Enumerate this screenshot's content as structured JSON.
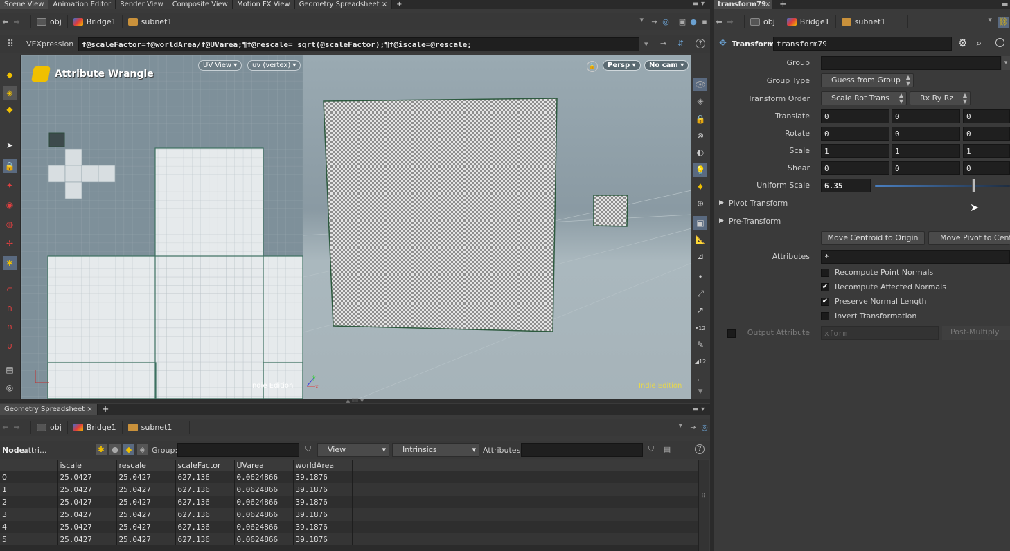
{
  "top_tabs": [
    "Scene View",
    "Animation Editor",
    "Render View",
    "Composite View",
    "Motion FX View",
    "Geometry Spreadsheet"
  ],
  "right_tab": "transform79",
  "path": {
    "obj": "obj",
    "bridge": "Bridge1",
    "subnet": "subnet1"
  },
  "vex": {
    "label": "VEXpression",
    "code": "f@scaleFactor=f@worldArea/f@UVarea;¶f@rescale= sqrt(@scaleFactor);¶f@iscale=@rescale;"
  },
  "uvview": {
    "title": "Attribute Wrangle",
    "uv_view_btn": "UV View ▾",
    "uv_vertex_btn": "uv (vertex) ▾",
    "edition": "Indie Edition"
  },
  "viewport": {
    "persp_btn": "Persp ▾",
    "cam_btn": "No cam ▾",
    "edition": "Indie Edition"
  },
  "params": {
    "node_type": "Transform",
    "node_name": "transform79",
    "group_label": "Group",
    "group_value": "",
    "group_type_label": "Group Type",
    "group_type_value": "Guess from Group",
    "order_label": "Transform Order",
    "order_value": "Scale Rot Trans",
    "rot_order_value": "Rx Ry Rz",
    "translate_label": "Translate",
    "translate": [
      "0",
      "0",
      "0"
    ],
    "rotate_label": "Rotate",
    "rotate": [
      "0",
      "0",
      "0"
    ],
    "scale_label": "Scale",
    "scale": [
      "1",
      "1",
      "1"
    ],
    "shear_label": "Shear",
    "shear": [
      "0",
      "0",
      "0"
    ],
    "uniform_label": "Uniform Scale",
    "uniform_value": "6.35",
    "uniform_slider_fraction": 0.73,
    "pivot_label": "Pivot Transform",
    "pre_label": "Pre-Transform",
    "centroid_btn": "Move Centroid to Origin",
    "pivot_btn": "Move Pivot to Centro",
    "attributes_label": "Attributes",
    "attributes_value": "*",
    "checks": [
      {
        "label": "Recompute Point Normals",
        "checked": false
      },
      {
        "label": "Recompute Affected Normals",
        "checked": true
      },
      {
        "label": "Preserve Normal Length",
        "checked": true
      },
      {
        "label": "Invert Transformation",
        "checked": false
      }
    ],
    "output_label": "Output Attribute",
    "output_value": "xform",
    "postmult": "Post-Multiply"
  },
  "spreadsheet": {
    "tab": "Geometry Spreadsheet",
    "node_label": "Node:",
    "node_value": "attri...",
    "group_label": "Group:",
    "view_label": "View",
    "intrinsics_label": "Intrinsics",
    "attributes_label": "Attributes:",
    "columns": [
      "",
      "iscale",
      "rescale",
      "scaleFactor",
      "UVarea",
      "worldArea"
    ],
    "rows": [
      [
        "0",
        "25.0427",
        "25.0427",
        "627.136",
        "0.0624866",
        "39.1876"
      ],
      [
        "1",
        "25.0427",
        "25.0427",
        "627.136",
        "0.0624866",
        "39.1876"
      ],
      [
        "2",
        "25.0427",
        "25.0427",
        "627.136",
        "0.0624866",
        "39.1876"
      ],
      [
        "3",
        "25.0427",
        "25.0427",
        "627.136",
        "0.0624866",
        "39.1876"
      ],
      [
        "4",
        "25.0427",
        "25.0427",
        "627.136",
        "0.0624866",
        "39.1876"
      ],
      [
        "5",
        "25.0427",
        "25.0427",
        "627.136",
        "0.0624866",
        "39.1876"
      ]
    ]
  },
  "colors": {
    "accent": "#f0c000",
    "edition": "#e8d84a"
  }
}
